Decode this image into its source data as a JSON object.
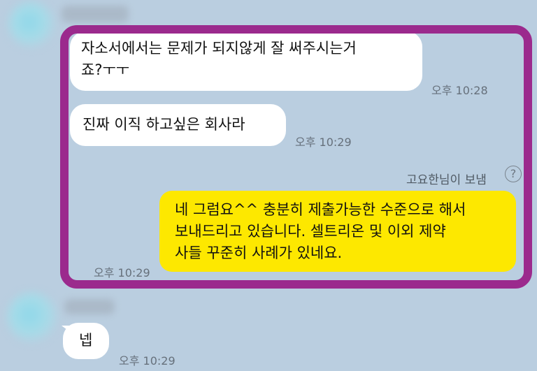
{
  "chat": {
    "messages": [
      {
        "direction": "incoming",
        "text": "자소서에서는 문제가 되지않게 잘 써주시는거\n죠?ㅜㅜ",
        "time": "오후 10:28"
      },
      {
        "direction": "incoming",
        "text": "진짜 이직 하고싶은 회사라",
        "time": "오후 10:29"
      },
      {
        "direction": "outgoing",
        "sender_label": "고요한님이 보냄",
        "text": "네 그럼요^^ 충분히 제출가능한 수준으로 해서\n보내드리고 있습니다. 셀트리온 및 이외 제약\n사들 꾸준히 사례가 있네요.",
        "time": "오후 10:29"
      },
      {
        "direction": "incoming",
        "text": "넵",
        "time": "오후 10:29"
      }
    ],
    "help_icon": {
      "name": "question-icon",
      "glyph": "?"
    }
  },
  "colors": {
    "background": "#bacee0",
    "incoming_bubble": "#ffffff",
    "outgoing_bubble": "#fde800",
    "highlight_border": "#9b2a8d"
  }
}
